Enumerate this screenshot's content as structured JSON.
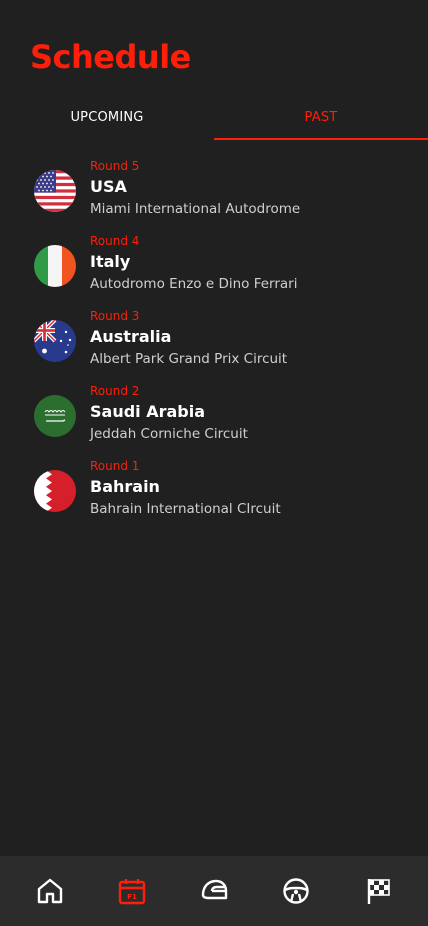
{
  "app": {
    "title": "Schedule"
  },
  "tabs": [
    {
      "label": "UPCOMING",
      "active": false
    },
    {
      "label": "PAST",
      "active": true
    }
  ],
  "races": [
    {
      "round": "Round 5",
      "country": "USA",
      "circuit": "Miami International Autodrome",
      "flag": "usa-flag-icon"
    },
    {
      "round": "Round 4",
      "country": "Italy",
      "circuit": "Autodromo Enzo e Dino Ferrari",
      "flag": "italy-flag-icon"
    },
    {
      "round": "Round 3",
      "country": "Australia",
      "circuit": "Albert Park Grand Prix Circuit",
      "flag": "australia-flag-icon"
    },
    {
      "round": "Round 2",
      "country": "Saudi Arabia",
      "circuit": "Jeddah Corniche Circuit",
      "flag": "saudi-arabia-flag-icon"
    },
    {
      "round": "Round 1",
      "country": "Bahrain",
      "circuit": "Bahrain International CIrcuit",
      "flag": "bahrain-flag-icon"
    }
  ],
  "nav": {
    "items": [
      {
        "icon": "home-icon",
        "active": false
      },
      {
        "icon": "calendar-icon",
        "active": true,
        "badge": "F1"
      },
      {
        "icon": "racing-helmet-icon",
        "active": false
      },
      {
        "icon": "steering-wheel-icon",
        "active": false
      },
      {
        "icon": "checkered-flag-icon",
        "active": false
      }
    ]
  },
  "colors": {
    "accent": "#ff1e0a",
    "background": "#202020",
    "nav_background": "#2c2c2c",
    "text": "#ffffff",
    "subtext": "#cfcfcf"
  }
}
